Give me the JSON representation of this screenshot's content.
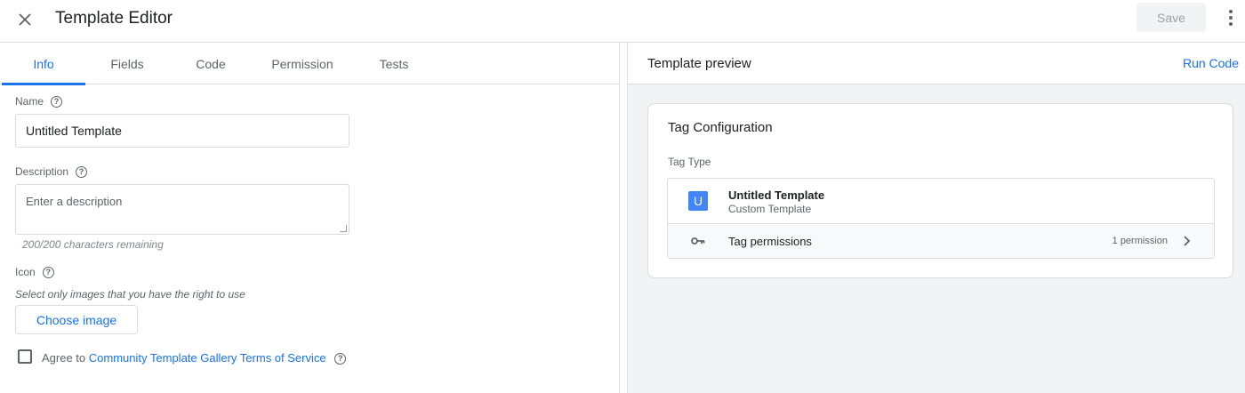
{
  "header": {
    "title": "Template Editor",
    "save_label": "Save"
  },
  "tabs": [
    {
      "label": "Info",
      "active": true
    },
    {
      "label": "Fields"
    },
    {
      "label": "Code"
    },
    {
      "label": "Permission"
    },
    {
      "label": "Tests"
    }
  ],
  "info": {
    "name_label": "Name",
    "name_value": "Untitled Template",
    "description_label": "Description",
    "description_placeholder": "Enter a description",
    "chars_remaining": "200/200 characters remaining",
    "icon_label": "Icon",
    "icon_hint": "Select only images that you have the right to use",
    "choose_image_label": "Choose image",
    "agree_prefix": "Agree to",
    "agree_link": "Community Template Gallery Terms of Service"
  },
  "preview": {
    "title": "Template preview",
    "run_code_label": "Run Code",
    "card_title": "Tag Configuration",
    "tag_type_label": "Tag Type",
    "tag_icon_letter": "U",
    "tag_name": "Untitled Template",
    "tag_subtitle": "Custom Template",
    "permissions_label": "Tag permissions",
    "permissions_count": "1 permission"
  },
  "colors": {
    "accent": "#1a73e8",
    "tag_icon_bg": "#4285f4",
    "panel_bg": "#f1f3f4"
  },
  "icons": [
    "close-icon",
    "more-vert-icon",
    "help-icon",
    "key-icon",
    "chevron-right-icon"
  ]
}
